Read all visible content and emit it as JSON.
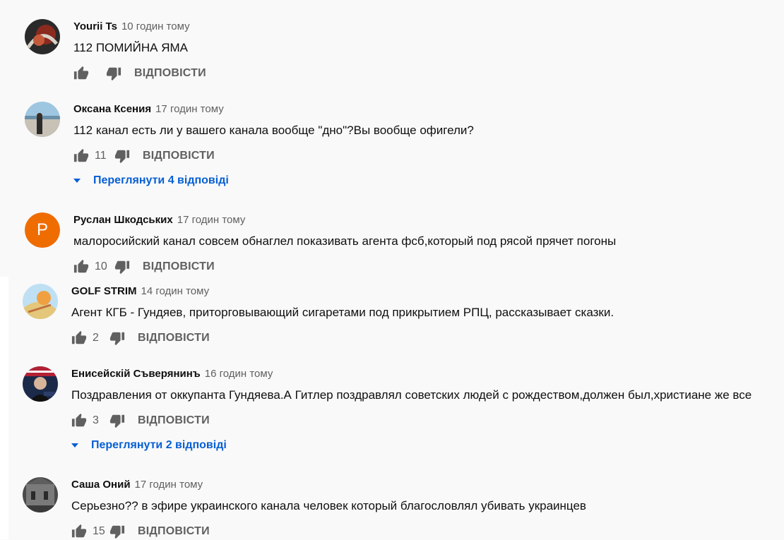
{
  "reply_label": "ВІДПОВІСТИ",
  "comments": [
    {
      "author": "Yourii Ts",
      "time": "10 годин тому",
      "text": "112  ПОМИЙНА ЯМА",
      "likes": ""
    },
    {
      "author": "Оксана Ксения",
      "time": "17 годин тому",
      "text": "112 канал есть ли у вашего канала вообще \"дно\"?Вы вообще офигели?",
      "likes": "11",
      "replies": "Переглянути 4 відповіді"
    },
    {
      "author": "Руслан Шкодських",
      "time": "17 годин тому",
      "text": "малоросийский канал совсем обнаглел показивать агента фсб,который под рясой прячет погоны",
      "likes": "10",
      "avatar_letter": "P"
    },
    {
      "author": "GOLF STRIM",
      "time": "14 годин тому",
      "text": "Агент КГБ - Гундяев, приторговывающий сигаретами под прикрытием РПЦ, рассказывает сказки.",
      "likes": "2"
    },
    {
      "author": "Енисейскiй Съверянинъ",
      "time": "16 годин тому",
      "text": "Поздравления от оккупанта Гундяева.А Гитлер поздравлял советских людей с рождеством,должен был,христиане же все",
      "likes": "3",
      "replies": "Переглянути 2 відповіді"
    },
    {
      "author": "Саша Оний",
      "time": "17 годин тому",
      "text": "Серьезно?? в эфире украинского канала человек который благословлял убивать украинцев",
      "likes": "15"
    }
  ],
  "colors": {
    "link": "#065fd4",
    "meta": "#606060",
    "avatar_orange": "#ef6c00"
  }
}
